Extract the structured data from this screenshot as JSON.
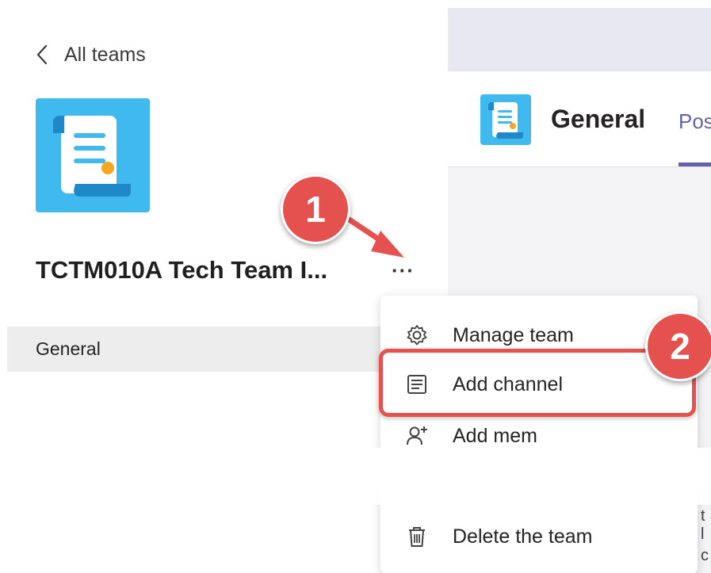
{
  "left_panel": {
    "back_label": "All teams",
    "team_name": "TCTM010A Tech Team I...",
    "more_options": "···",
    "channels": [
      {
        "label": "General"
      }
    ]
  },
  "channel_header": {
    "title": "General",
    "tab_posts": "Pos"
  },
  "right_pane_peek": [
    "t l",
    "c"
  ],
  "menu": {
    "items": [
      {
        "label": "Manage team",
        "icon": "gear-icon"
      },
      {
        "label": "Add channel",
        "icon": "channel-list-icon"
      },
      {
        "label": "Add mem",
        "icon": "add-member-icon"
      },
      {
        "label": "Delete the team",
        "icon": "trash-icon"
      }
    ]
  },
  "annotations": {
    "step1": "1",
    "step2": "2"
  },
  "colors": {
    "accent": "#6264a7",
    "team_icon_bg": "#40b9ee",
    "annotation_red": "#e5514f",
    "selected_row": "#ededed"
  }
}
